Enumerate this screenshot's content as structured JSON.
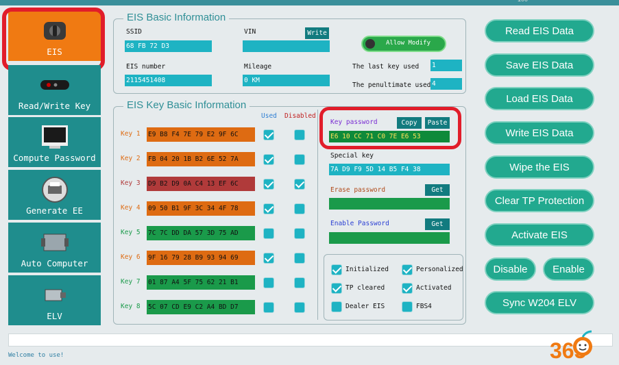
{
  "topbar": {
    "number": "100"
  },
  "nav": [
    {
      "label": "EIS",
      "icon": "ignition-switch-icon",
      "active": true
    },
    {
      "label": "Read/Write Key",
      "icon": "car-key-icon"
    },
    {
      "label": "Compute Password",
      "icon": "computer-icon"
    },
    {
      "label": "Generate EE",
      "icon": "printer-icon"
    },
    {
      "label": "Auto Computer",
      "icon": "ecu-module-icon"
    },
    {
      "label": "ELV",
      "icon": "elv-module-icon"
    }
  ],
  "basic": {
    "title": "EIS Basic Information",
    "ssid_label": "SSID",
    "ssid_value": "68 FB 72 D3",
    "vin_label": "VIN",
    "vin_value": "",
    "write_label": "Write",
    "allow_label": "Allow Modify",
    "eis_label": "EIS number",
    "eis_value": "2115451408",
    "mileage_label": "Mileage",
    "mileage_value": "0 KM",
    "last_key_label": "The last key used",
    "last_key_value": "1",
    "penult_label": "The penultimate used",
    "penult_value": "4"
  },
  "keys": {
    "title": "EIS Key Basic Information",
    "used_header": "Used",
    "disabled_header": "Disabled",
    "rows": [
      {
        "label": "Key 1",
        "value": "E9 B8 F4 7E 79 E2 9F 6C",
        "used": true,
        "disabled": false,
        "color": "#de6b12"
      },
      {
        "label": "Key 2",
        "value": "FB 04 20 1B B2 6E 52 7A",
        "used": true,
        "disabled": false,
        "color": "#de6b12"
      },
      {
        "label": "Key 3",
        "value": "D9 B2 D9 0A C4 13 EF 6C",
        "used": true,
        "disabled": true,
        "color": "#b03a3a"
      },
      {
        "label": "Key 4",
        "value": "09 50 B1 9F 3C 34 4F 78",
        "used": true,
        "disabled": false,
        "color": "#de6b12"
      },
      {
        "label": "Key 5",
        "value": "7C 7C DD DA 57 3D 75 AD",
        "used": false,
        "disabled": false,
        "color": "#1a9a4a"
      },
      {
        "label": "Key 6",
        "value": "9F 16 79 28 B9 93 94 69",
        "used": true,
        "disabled": false,
        "color": "#de6b12"
      },
      {
        "label": "Key 7",
        "value": "01 87 A4 5F 75 62 21 B1",
        "used": false,
        "disabled": false,
        "color": "#1a9a4a"
      },
      {
        "label": "Key 8",
        "value": "5C 07 CD E9 C2 A4 BD D7",
        "used": false,
        "disabled": false,
        "color": "#1a9a4a"
      }
    ],
    "key_password_label": "Key password",
    "key_password_value": "E6 10 CC 71 C0 7E E6 53",
    "copy_label": "Copy",
    "paste_label": "Paste",
    "special_key_label": "Special key",
    "special_key_value": "7A D9 F9 5D 14 B5 F4 38",
    "erase_label": "Erase password",
    "erase_get": "Get",
    "enable_label": "Enable Password",
    "enable_get": "Get",
    "flags": [
      {
        "label": "Initialized",
        "checked": true
      },
      {
        "label": "Personalized",
        "checked": true
      },
      {
        "label": "TP cleared",
        "checked": true
      },
      {
        "label": "Activated",
        "checked": true
      },
      {
        "label": "Dealer EIS",
        "checked": false
      },
      {
        "label": "FBS4",
        "checked": false
      }
    ]
  },
  "actions": {
    "read": "Read  EIS Data",
    "save": "Save EIS Data",
    "load": "Load EIS Data",
    "write": "Write EIS Data",
    "wipe": "Wipe the EIS",
    "clear_tp": "Clear TP Protection",
    "activate": "Activate EIS",
    "disable": "Disable",
    "enable": "Enable",
    "sync": "Sync W204 ELV"
  },
  "status": {
    "welcome": "Welcome to use!"
  },
  "watermark": {
    "text": "365"
  },
  "colors": {
    "accent": "#1eb3c3",
    "nav": "#1f8d8d",
    "active": "#f07a12",
    "highlight": "#e11d2a",
    "green": "#1a9a4a"
  }
}
